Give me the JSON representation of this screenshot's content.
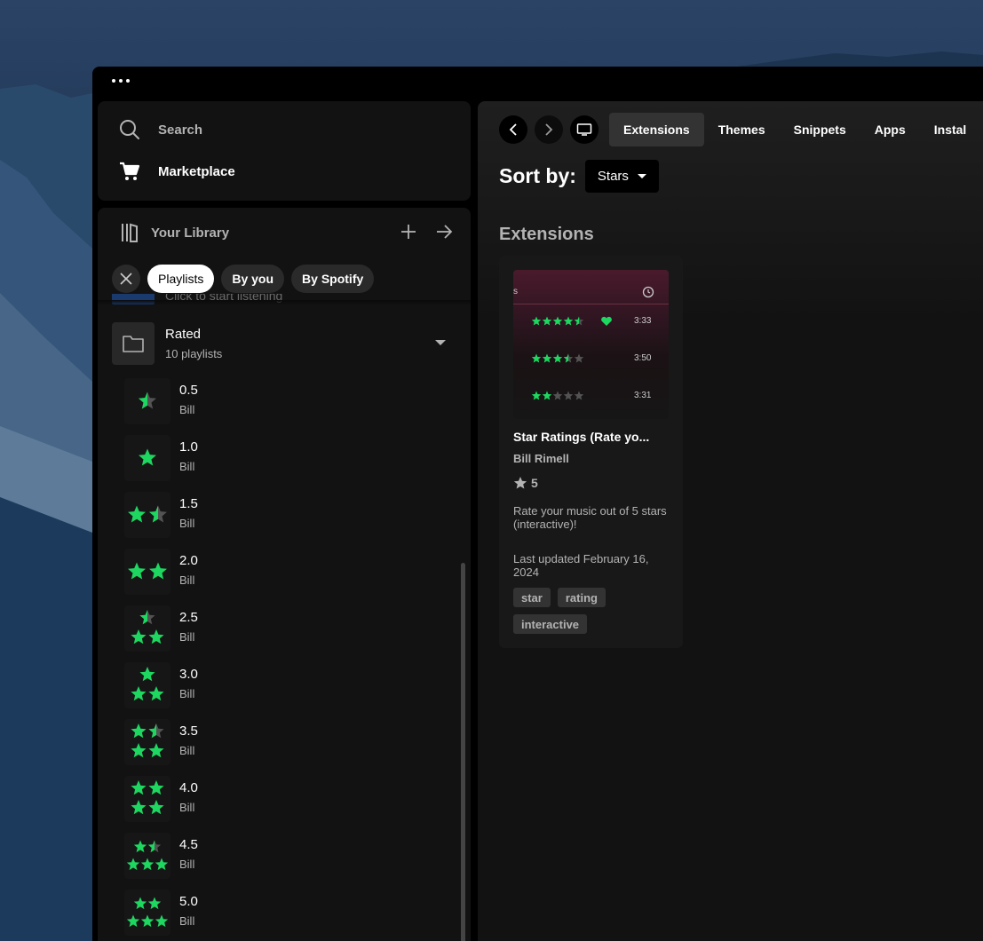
{
  "window": {
    "menu_icon": "ellipsis-icon"
  },
  "nav": {
    "search_label": "Search",
    "marketplace_label": "Marketplace"
  },
  "library": {
    "title": "Your Library",
    "filters": {
      "active": "Playlists",
      "by_you": "By you",
      "by_spotify": "By Spotify"
    },
    "previous_item_subtitle": "Click to start listening",
    "folder": {
      "name": "Rated",
      "subtitle": "10 playlists"
    },
    "playlists": [
      {
        "name": "0.5",
        "owner": "Bill",
        "rating": 0.5
      },
      {
        "name": "1.0",
        "owner": "Bill",
        "rating": 1.0
      },
      {
        "name": "1.5",
        "owner": "Bill",
        "rating": 1.5
      },
      {
        "name": "2.0",
        "owner": "Bill",
        "rating": 2.0
      },
      {
        "name": "2.5",
        "owner": "Bill",
        "rating": 2.5
      },
      {
        "name": "3.0",
        "owner": "Bill",
        "rating": 3.0
      },
      {
        "name": "3.5",
        "owner": "Bill",
        "rating": 3.5
      },
      {
        "name": "4.0",
        "owner": "Bill",
        "rating": 4.0
      },
      {
        "name": "4.5",
        "owner": "Bill",
        "rating": 4.5
      },
      {
        "name": "5.0",
        "owner": "Bill",
        "rating": 5.0
      }
    ]
  },
  "main": {
    "tabs": [
      "Extensions",
      "Themes",
      "Snippets",
      "Apps",
      "Instal"
    ],
    "active_tab": "Extensions",
    "sort_label": "Sort by:",
    "sort_value": "Stars",
    "section_title": "Extensions",
    "card": {
      "title": "Star Ratings (Rate yo...",
      "author": "Bill Rimell",
      "stars": "5",
      "description": "Rate your music out of 5 stars (interactive)!",
      "updated": "Last updated February 16, 2024",
      "tags": [
        "star",
        "rating",
        "interactive"
      ],
      "preview": {
        "header_fragment": "s",
        "rows": [
          {
            "rating": 4.5,
            "liked": true,
            "time": "3:33"
          },
          {
            "rating": 3.5,
            "liked": false,
            "time": "3:50"
          },
          {
            "rating": 2.0,
            "liked": false,
            "time": "3:31"
          }
        ]
      }
    }
  },
  "colors": {
    "accent": "#1ed760",
    "bg": "#121212",
    "panel": "#000000",
    "star_empty": "#535353"
  }
}
